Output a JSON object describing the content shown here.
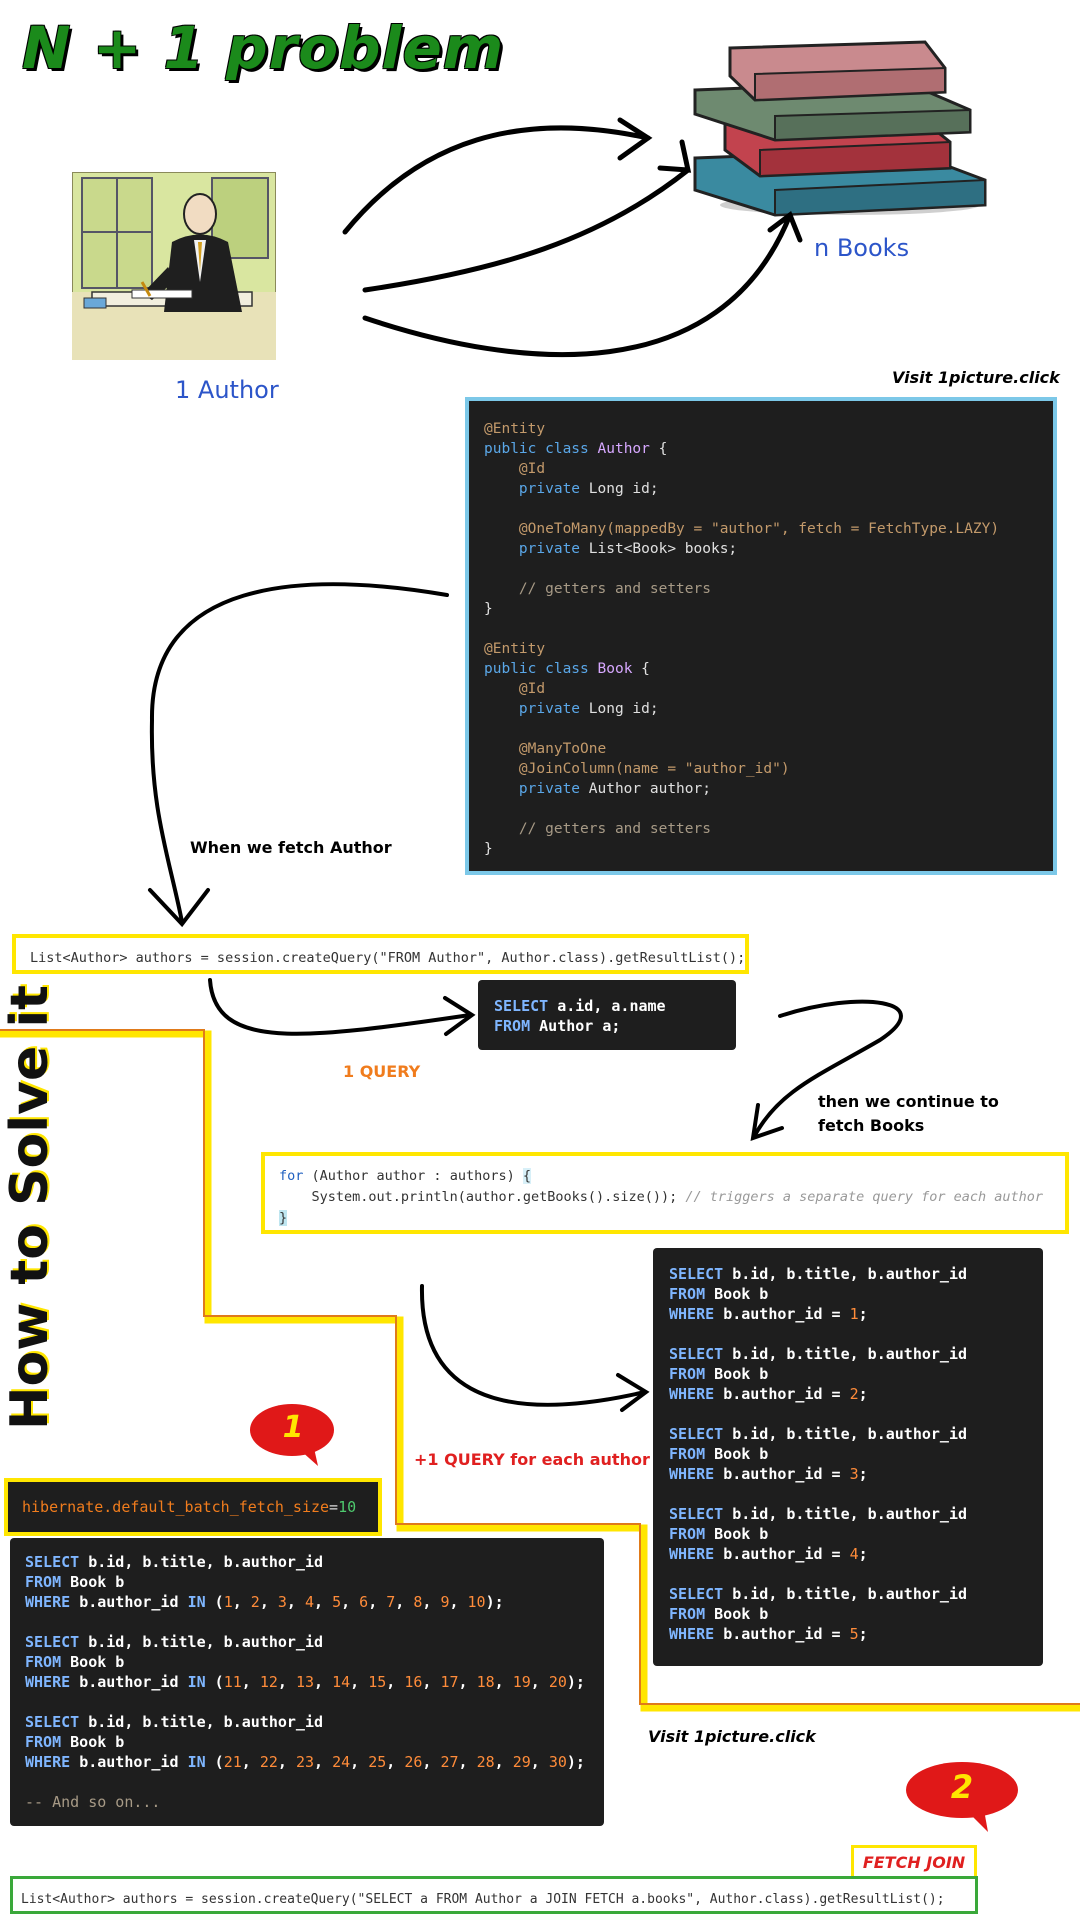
{
  "title": "N + 1 problem",
  "labels": {
    "author": "1  Author",
    "books": "n  Books",
    "visit_top": "Visit 1picture.click",
    "visit_bottom": "Visit 1picture.click",
    "when_fetch": "When we fetch Author",
    "one_query": "1 QUERY",
    "then_continue": "then we continue to",
    "fetch_books": "fetch Books",
    "plus_one": "+1 QUERY for each author",
    "how_to_solve": "How to Solve it",
    "badge_1": "1",
    "badge_2": "2",
    "fetch_join": "FETCH JOIN",
    "and_so_on": "-- And so on..."
  },
  "entity_code": {
    "ann_entity": "@Entity",
    "author_class": "Author",
    "book_class": "Book",
    "ann_id": "@Id",
    "ann_onetomany": "@OneToMany(mappedBy = \"author\", fetch = FetchType.LAZY)",
    "ann_manytoone": "@ManyToOne",
    "ann_joincolumn": "@JoinColumn(name = \"author_id\")",
    "comment": "// getters and setters"
  },
  "query_line": "List<Author> authors = session.createQuery(\"FROM Author\", Author.class).getResultList();",
  "loop_comment": "// triggers a separate query for each author",
  "batch_setting": "hibernate.default_batch_fetch_size",
  "batch_value": "10",
  "author_ids": [
    "1",
    "2",
    "3",
    "4",
    "5"
  ],
  "batches": [
    [
      "1",
      "2",
      "3",
      "4",
      "5",
      "6",
      "7",
      "8",
      "9",
      "10"
    ],
    [
      "11",
      "12",
      "13",
      "14",
      "15",
      "16",
      "17",
      "18",
      "19",
      "20"
    ],
    [
      "21",
      "22",
      "23",
      "24",
      "25",
      "26",
      "27",
      "28",
      "29",
      "30"
    ]
  ],
  "fetch_join_line": "List<Author> authors = session.createQuery(\"SELECT a FROM Author a JOIN FETCH a.books\", Author.class).getResultList();",
  "colors": {
    "title_green": "#1b8a1b",
    "label_blue": "#2c55c9",
    "yellow_border": "#ffe600",
    "cyan_border": "#7cc8e8",
    "green_border": "#3aa83a",
    "orange": "#f07c1d",
    "red": "#e02020"
  }
}
